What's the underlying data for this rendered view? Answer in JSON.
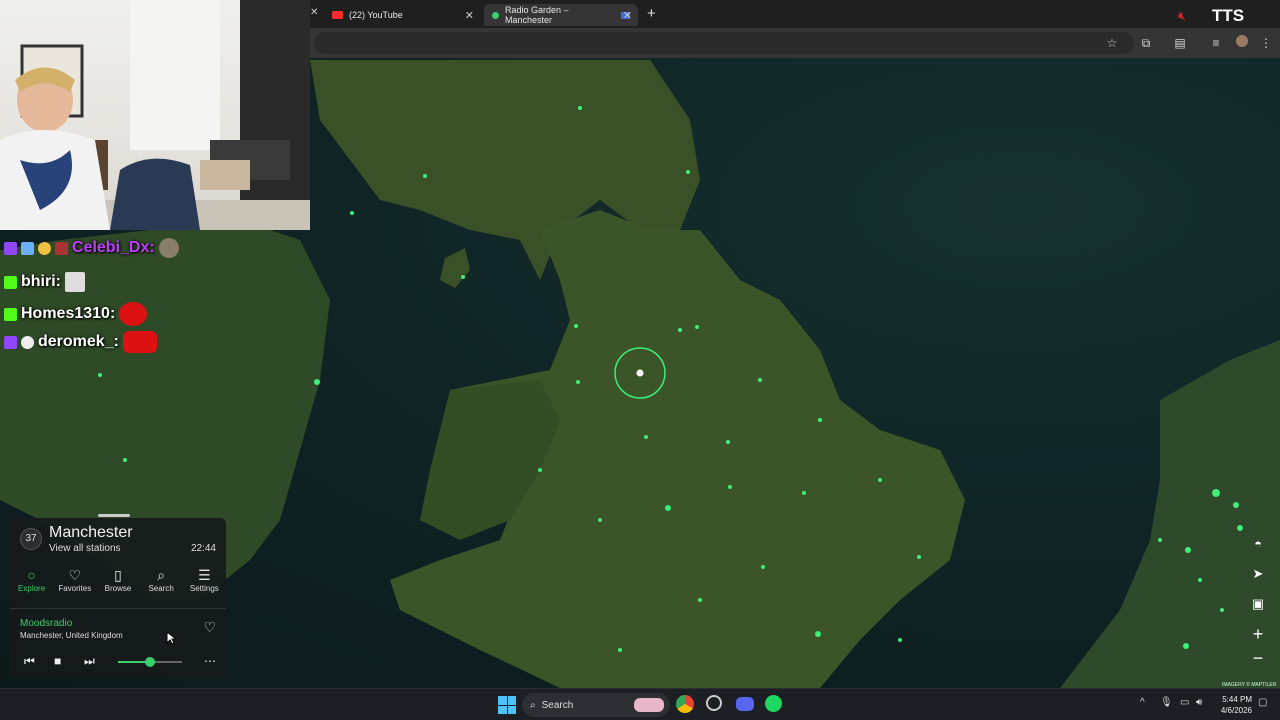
{
  "browser": {
    "tabs": [
      {
        "title": "(22) YouTube"
      },
      {
        "title": "Radio Garden – Manchester"
      }
    ],
    "new_tab": "+"
  },
  "overlay": {
    "tts_label": "TTS"
  },
  "chat": {
    "messages": [
      {
        "user": "Celebi_Dx:",
        "color": "#c03cff"
      },
      {
        "user": "bhiri:",
        "color": "#ffffff"
      },
      {
        "user": "Homes1310:",
        "color": "#ffffff"
      },
      {
        "user": "deromek_:",
        "color": "#ffffff"
      }
    ]
  },
  "radio": {
    "location_count": "37",
    "location_name": "Manchester",
    "view_all": "View all stations",
    "local_time": "22:44",
    "nav": [
      {
        "label": "Explore",
        "icon": "explore-icon"
      },
      {
        "label": "Favorites",
        "icon": "heart-icon"
      },
      {
        "label": "Browse",
        "icon": "map-icon"
      },
      {
        "label": "Search",
        "icon": "search-icon"
      },
      {
        "label": "Settings",
        "icon": "settings-icon"
      }
    ],
    "station_name": "Moodsradio",
    "station_location": "Manchester, United Kingdom",
    "volume": 0.5,
    "accent": "#3ad06a"
  },
  "map": {
    "attribution": "IMAGERY © MAPTILER"
  },
  "taskbar": {
    "search_label": "Search",
    "time": "5:44 PM",
    "date": "4/6/2026"
  }
}
